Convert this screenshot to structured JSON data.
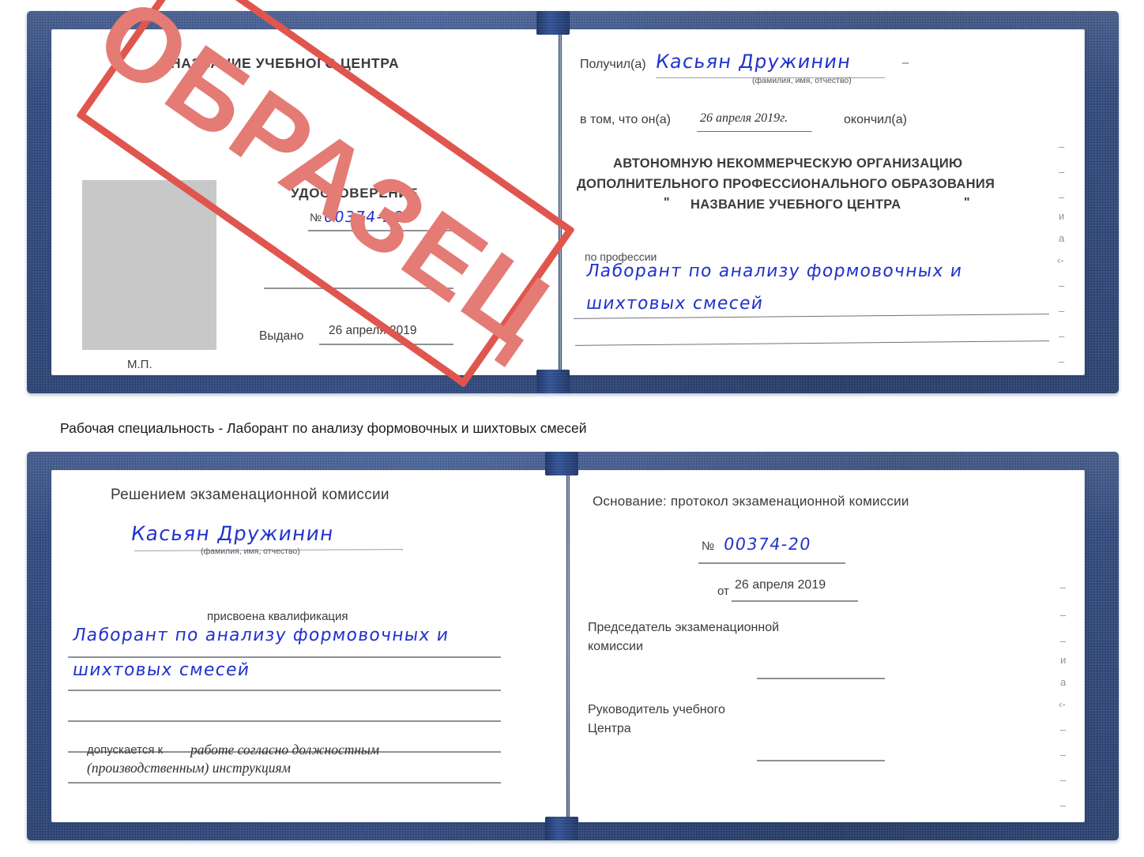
{
  "caption": "Рабочая специальность - Лаборант по анализу формовочных и шихтовых смесей",
  "stamp": {
    "label": "ОБРАЗЕЦ",
    "frame_color": "#e0564e",
    "text_color": "#e47b74"
  },
  "colors": {
    "cover_blue": "#22407f",
    "ink_blue": "#2233cc",
    "stamp_red": "#e0564e",
    "rule_gray": "#8e9298",
    "photo_gray": "#c8c8c8",
    "text_gray": "#3b3b3f"
  },
  "certificate_top": {
    "left_page": {
      "org_title": "НАЗВАНИЕ УЧЕБНОГО ЦЕНТРА",
      "doc_type": "УДОСТОВЕРЕНИЕ",
      "number_symbol": "№",
      "number_value": "00374-20",
      "issued_label": "Выдано",
      "issued_value": "26 апреля 2019",
      "seal_label": "М.П."
    },
    "right_page": {
      "received_label": "Получил(а)",
      "received_value": "Касьян Дружинин",
      "received_hint": "(фамилия, имя, отчество)",
      "in_that_label": "в том, что он(а)",
      "in_that_value": "26 апреля 2019г.",
      "finished_label": "окончил(а)",
      "org_line1": "АВТОНОМНУЮ НЕКОММЕРЧЕСКУЮ ОРГАНИЗАЦИЮ",
      "org_line2": "ДОПОЛНИТЕЛЬНОГО ПРОФЕССИОНАЛЬНОГО ОБРАЗОВАНИЯ",
      "org_quote_open": "\"",
      "org_line3": "НАЗВАНИЕ УЧЕБНОГО ЦЕНТРА",
      "org_quote_close": "\"",
      "profession_label": "по профессии",
      "profession_value_line1": "Лаборант по анализу формовочных и",
      "profession_value_line2": "шихтовых смесей"
    }
  },
  "certificate_bottom": {
    "left_page": {
      "decision_title": "Решением экзаменационной комиссии",
      "name_value": "Касьян Дружинин",
      "name_hint": "(фамилия, имя, отчество)",
      "qualification_label": "присвоена квалификация",
      "qualification_line1": "Лаборант по анализу формовочных и",
      "qualification_line2": "шихтовых смесей",
      "allowed_label": "допускается к",
      "allowed_value_line1": "работе согласно должностным",
      "allowed_value_line2": "(производственным) инструкциям"
    },
    "right_page": {
      "basis_label": "Основание: протокол экзаменационной комиссии",
      "protocol_number_symbol": "№",
      "protocol_number_value": "00374-20",
      "protocol_date_label": "от",
      "protocol_date_value": "26 апреля 2019",
      "chairman_line1": "Председатель экзаменационной",
      "chairman_line2": "комиссии",
      "head_line1": "Руководитель учебного",
      "head_line2": "Центра"
    }
  },
  "bleed_marks_top": [
    "–",
    "–",
    "–",
    "и",
    "а",
    "‹-",
    "–",
    "–",
    "–",
    "–"
  ],
  "bleed_marks_bottom": [
    "–",
    "–",
    "–",
    "и",
    "а",
    "‹-",
    "–",
    "–",
    "–",
    "–"
  ]
}
